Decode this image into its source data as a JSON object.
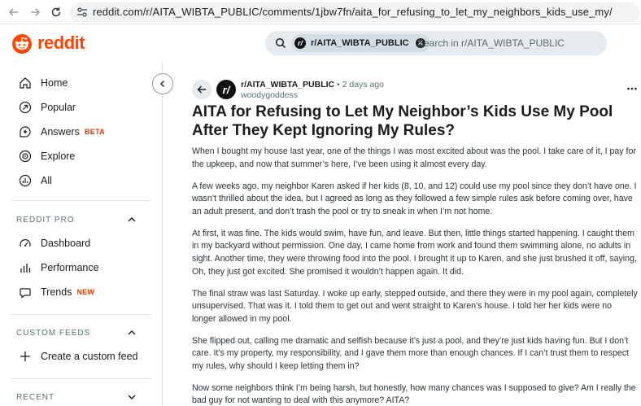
{
  "browser": {
    "url": "reddit.com/r/AITA_WIBTA_PUBLIC/comments/1jbw7fn/aita_for_refusing_to_let_my_neighbors_kids_use_my/"
  },
  "header": {
    "logo_text": "reddit",
    "search": {
      "chip_label": "r/AITA_WIBTA_PUBLIC",
      "chip_avatar": "r/",
      "placeholder": "Search in r/AITA_WIBTA_PUBLIC"
    }
  },
  "sidebar": {
    "nav": [
      {
        "label": "Home",
        "icon": "home-icon"
      },
      {
        "label": "Popular",
        "icon": "popular-icon"
      },
      {
        "label": "Answers",
        "icon": "answers-icon",
        "badge": "BETA"
      },
      {
        "label": "Explore",
        "icon": "explore-icon"
      },
      {
        "label": "All",
        "icon": "all-icon"
      }
    ],
    "reddit_pro": {
      "title": "REDDIT PRO",
      "items": [
        {
          "label": "Dashboard",
          "icon": "dashboard-icon"
        },
        {
          "label": "Performance",
          "icon": "performance-icon"
        },
        {
          "label": "Trends",
          "icon": "trends-icon",
          "badge": "NEW"
        }
      ]
    },
    "custom_feeds": {
      "title": "CUSTOM FEEDS",
      "items": [
        {
          "label": "Create a custom feed",
          "icon": "plus-icon"
        }
      ]
    },
    "recent": {
      "title": "RECENT"
    }
  },
  "post": {
    "avatar": "r/",
    "subreddit": "r/AITA_WIBTA_PUBLIC",
    "time": "• 2 days ago",
    "author": "woodygoddess",
    "title": "AITA for Refusing to Let My Neighbor’s Kids Use My Pool After They Kept Ignoring My Rules?",
    "paragraphs": [
      "When I bought my house last year, one of the things I was most excited about was the pool. I take care of it, I pay for the upkeep, and now that summer’s here, I’ve been using it almost every day.",
      "A few weeks ago, my neighbor Karen asked if her kids (8, 10, and 12) could use my pool since they don’t have one. I wasn’t thrilled about the idea, but I agreed as long as they followed a few simple rules ask before coming over, have an adult present, and don’t trash the pool or try to sneak in when I’m not home.",
      "At first, it was fine. The kids would swim, have fun, and leave. But then, little things started happening. I caught them in my backyard without permission. One day, I came home from work and found them swimming alone, no adults in sight. Another time, they were throwing food into the pool. I brought it up to Karen, and she just brushed it off, saying, Oh, they just got excited. She promised it wouldn’t happen again. It did.",
      "The final straw was last Saturday. I woke up early, stepped outside, and there they were in my pool again, completely unsupervised. That was it. I told them to get out and went straight to Karen’s house. I told her her kids were no longer allowed in my pool.",
      "She flipped out, calling me dramatic and selfish because it’s just a pool, and they’re just kids having fun. But I don’t care. It’s my property, my responsibility, and I gave them more than enough chances. If I can’t trust them to respect my rules, why should I keep letting them in?",
      "Now some neighbors think I’m being harsh, but honestly, how many chances was I supposed to give? Am I really the bad guy for not wanting to deal with this anymore? AITA?"
    ]
  },
  "colors": {
    "brand": "#ff4500",
    "badge": "#d93900",
    "search_bg": "#e5ebee"
  }
}
